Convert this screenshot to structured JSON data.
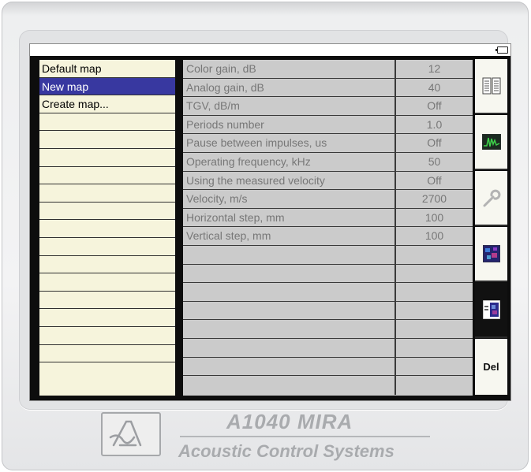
{
  "maps": {
    "items": [
      {
        "label": "Default map",
        "selected": false
      },
      {
        "label": "New map",
        "selected": true
      },
      {
        "label": "Create map...",
        "selected": false
      },
      {
        "label": ""
      },
      {
        "label": ""
      },
      {
        "label": ""
      },
      {
        "label": ""
      },
      {
        "label": ""
      },
      {
        "label": ""
      },
      {
        "label": ""
      },
      {
        "label": ""
      },
      {
        "label": ""
      },
      {
        "label": ""
      },
      {
        "label": ""
      },
      {
        "label": ""
      },
      {
        "label": ""
      },
      {
        "label": ""
      },
      {
        "label": ""
      }
    ]
  },
  "parameters": {
    "rows": [
      {
        "label": "Color gain, dB",
        "value": "12"
      },
      {
        "label": "Analog gain, dB",
        "value": "40"
      },
      {
        "label": "TGV, dB/m",
        "value": "Off"
      },
      {
        "label": "Periods number",
        "value": "1.0"
      },
      {
        "label": "Pause between impulses, us",
        "value": "Off"
      },
      {
        "label": "Operating frequency, kHz",
        "value": "50"
      },
      {
        "label": "Using the measured velocity",
        "value": "Off"
      },
      {
        "label": "Velocity, m/s",
        "value": "2700"
      },
      {
        "label": "Horizontal step, mm",
        "value": "100"
      },
      {
        "label": "Vertical step, mm",
        "value": "100"
      },
      {
        "label": "",
        "value": ""
      },
      {
        "label": "",
        "value": ""
      },
      {
        "label": "",
        "value": ""
      },
      {
        "label": "",
        "value": ""
      },
      {
        "label": "",
        "value": ""
      },
      {
        "label": "",
        "value": ""
      },
      {
        "label": "",
        "value": ""
      },
      {
        "label": "",
        "value": ""
      }
    ]
  },
  "toolbar": {
    "buttons": [
      {
        "icon": "document-list-icon",
        "active": false
      },
      {
        "icon": "oscilloscope-icon",
        "active": false
      },
      {
        "icon": "wrench-icon",
        "active": false
      },
      {
        "icon": "tomogram-map-icon",
        "active": false
      },
      {
        "icon": "map-parameters-icon",
        "active": true
      },
      {
        "icon": "delete-button",
        "label": "Del",
        "active": false
      }
    ]
  },
  "branding": {
    "model": "A1040 MIRA",
    "company": "Acoustic Control Systems"
  },
  "colors": {
    "selection": "#3838a0",
    "list_bg": "#f6f4dc",
    "table_bg": "#cbcbcb",
    "brand_text": "#a9abae"
  }
}
